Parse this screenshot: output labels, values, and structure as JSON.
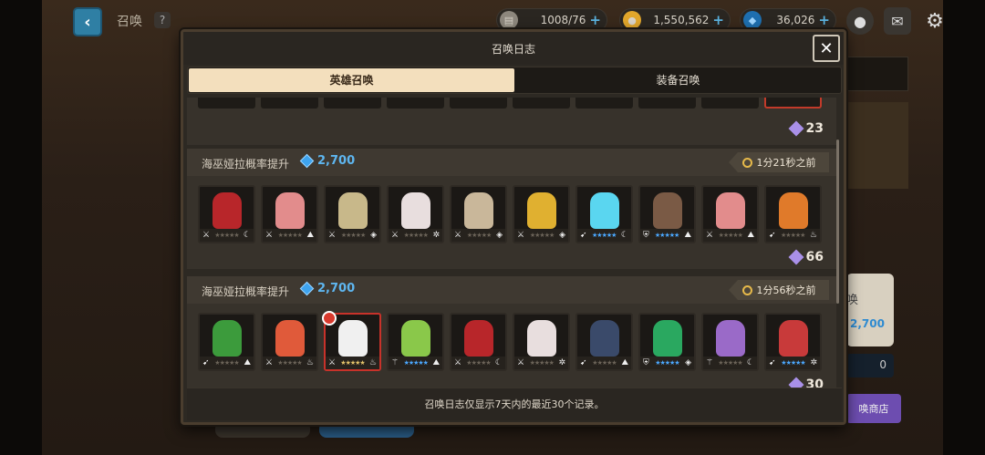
{
  "topbar": {
    "title": "召唤",
    "help": "?",
    "resources": [
      {
        "icon": "stamina-icon",
        "value": "1008/76",
        "color": "#9a948a"
      },
      {
        "icon": "gold-coin-icon",
        "value": "1,550,562",
        "color": "#e1a62b"
      },
      {
        "icon": "diamond-icon",
        "value": "36,026",
        "color": "#38a2ee"
      }
    ]
  },
  "background": {
    "side_title": "唤",
    "side_cost": "2,700",
    "side_count": "0",
    "side_button": "唤商店"
  },
  "modal": {
    "title": "召唤日志",
    "close": "✕",
    "tabs": [
      {
        "label": "英雄召唤",
        "active": true
      },
      {
        "label": "装备召唤",
        "active": false
      }
    ],
    "top_count": "23",
    "entries": [
      {
        "name": "海巫娅拉概率提升",
        "cost": "2,700",
        "time": "1分21秒之前",
        "count": "66",
        "heroes": [
          {
            "name": "hero-ninja-red",
            "color": "#b8262a",
            "stars": "gray",
            "class_icon": "sword-icon",
            "element_icon": "moon-icon"
          },
          {
            "name": "hero-pink-hair",
            "color": "#e28c8c",
            "stars": "gray",
            "class_icon": "sword-icon",
            "element_icon": "earth-icon"
          },
          {
            "name": "hero-blonde",
            "color": "#c8b88a",
            "stars": "gray",
            "class_icon": "sword-icon",
            "element_icon": "light-icon"
          },
          {
            "name": "hero-white-beast",
            "color": "#e8dede",
            "stars": "gray",
            "class_icon": "sword-icon",
            "element_icon": "basic-icon"
          },
          {
            "name": "hero-sheep",
            "color": "#c9b79a",
            "stars": "gray",
            "class_icon": "sword-icon",
            "element_icon": "light-icon"
          },
          {
            "name": "hero-spiky-blonde",
            "color": "#e0b030",
            "stars": "gray",
            "class_icon": "sword-icon",
            "element_icon": "light-icon"
          },
          {
            "name": "hero-ice-dragon",
            "color": "#5ad6f0",
            "stars": "blue",
            "class_icon": "bow-icon",
            "element_icon": "moon-icon"
          },
          {
            "name": "hero-golem",
            "color": "#7a5a45",
            "stars": "blue",
            "class_icon": "shield-icon",
            "element_icon": "earth-icon"
          },
          {
            "name": "hero-pink-hair-2",
            "color": "#e28c8c",
            "stars": "gray",
            "class_icon": "sword-icon",
            "element_icon": "earth-icon"
          },
          {
            "name": "hero-phoenix-girl",
            "color": "#e07a2a",
            "stars": "gray",
            "class_icon": "bow-icon",
            "element_icon": "fire-icon"
          }
        ]
      },
      {
        "name": "海巫娅拉概率提升",
        "cost": "2,700",
        "time": "1分56秒之前",
        "count": "30",
        "heroes": [
          {
            "name": "hero-green-hat",
            "color": "#3c9b3c",
            "stars": "gray",
            "class_icon": "bow-icon",
            "element_icon": "earth-icon"
          },
          {
            "name": "hero-fox-girl",
            "color": "#e05a3a",
            "stars": "gray",
            "class_icon": "sword-icon",
            "element_icon": "fire-icon"
          },
          {
            "name": "hero-white-panda",
            "color": "#f0f0f0",
            "stars": "gold",
            "class_icon": "sword-icon",
            "element_icon": "fire-icon",
            "featured": true
          },
          {
            "name": "hero-flower-girl",
            "color": "#8ac84a",
            "stars": "blue",
            "class_icon": "staff-icon",
            "element_icon": "earth-icon"
          },
          {
            "name": "hero-ninja-red-2",
            "color": "#b8262a",
            "stars": "gray",
            "class_icon": "sword-icon",
            "element_icon": "moon-icon"
          },
          {
            "name": "hero-white-beast-2",
            "color": "#e8dede",
            "stars": "gray",
            "class_icon": "sword-icon",
            "element_icon": "basic-icon"
          },
          {
            "name": "hero-pirate",
            "color": "#3a4a6a",
            "stars": "gray",
            "class_icon": "bow-icon",
            "element_icon": "earth-icon"
          },
          {
            "name": "hero-dragon-rider",
            "color": "#2aa860",
            "stars": "blue",
            "class_icon": "shield-icon",
            "element_icon": "light-icon"
          },
          {
            "name": "hero-horned-girl",
            "color": "#9a6ac8",
            "stars": "gray",
            "class_icon": "staff-icon",
            "element_icon": "moon-icon"
          },
          {
            "name": "hero-red-captain",
            "color": "#c83a3a",
            "stars": "blue",
            "class_icon": "bow-icon",
            "element_icon": "basic-icon"
          }
        ]
      }
    ],
    "footer_note": "召唤日志仅显示7天内的最近30个记录。"
  }
}
